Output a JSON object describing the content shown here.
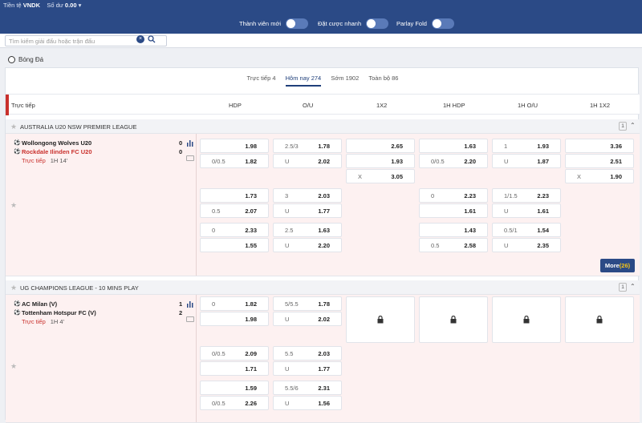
{
  "topbar": {
    "currency_label": "Tiền tệ",
    "currency": "VNDK",
    "balance_label": "Số dư",
    "balance": "0.00"
  },
  "toggles": [
    {
      "label": "Thành viên mới"
    },
    {
      "label": "Đặt cược nhanh"
    },
    {
      "label": "Parlay Fold"
    }
  ],
  "search": {
    "placeholder": "Tìm kiếm giải đấu hoặc trận đấu",
    "clear": "×"
  },
  "sport": "Bóng Đá",
  "tabs": [
    "Trực tiếp 4",
    "Hôm nay 274",
    "Sớm 1902",
    "Toàn bộ 86"
  ],
  "active_tab": 1,
  "columns": {
    "live": "Trực tiếp",
    "hdp": "HDP",
    "ou": "O/U",
    "x12": "1X2",
    "h1hdp": "1H HDP",
    "h1ou": "1H O/U",
    "h1x12": "1H 1X2"
  },
  "leagues": [
    {
      "name": "AUSTRALIA U20 NSW PREMIER LEAGUE",
      "count": "1",
      "match": {
        "home": "Wollongong Wolves U20",
        "away": "Rockdale Ilinden FC U20",
        "home_score": "0",
        "away_score": "0",
        "live": "Trực tiếp",
        "time": "1H 14'",
        "more_label": "More",
        "more_count": "(26)"
      },
      "cells": [
        {
          "col": 0,
          "row": 0,
          "h": "",
          "o": "1.98"
        },
        {
          "col": 0,
          "row": 1,
          "h": "0/0.5",
          "o": "1.82"
        },
        {
          "col": 1,
          "row": 0,
          "h": "2.5/3",
          "o": "1.78"
        },
        {
          "col": 1,
          "row": 1,
          "h": "U",
          "o": "2.02"
        },
        {
          "col": 2,
          "row": 0,
          "h": "",
          "o": "2.65"
        },
        {
          "col": 2,
          "row": 1,
          "h": "",
          "o": "1.93"
        },
        {
          "col": 2,
          "row": 2,
          "h": "X",
          "o": "3.05"
        },
        {
          "col": 3,
          "row": 0,
          "h": "",
          "o": "1.63"
        },
        {
          "col": 3,
          "row": 1,
          "h": "0/0.5",
          "o": "2.20"
        },
        {
          "col": 4,
          "row": 0,
          "h": "1",
          "o": "1.93"
        },
        {
          "col": 4,
          "row": 1,
          "h": "U",
          "o": "1.87"
        },
        {
          "col": 5,
          "row": 0,
          "h": "",
          "o": "3.36"
        },
        {
          "col": 5,
          "row": 1,
          "h": "",
          "o": "2.51"
        },
        {
          "col": 5,
          "row": 2,
          "h": "X",
          "o": "1.90"
        },
        {
          "col": 0,
          "row": 3,
          "h": "",
          "o": "1.73"
        },
        {
          "col": 0,
          "row": 4,
          "h": "0.5",
          "o": "2.07"
        },
        {
          "col": 1,
          "row": 3,
          "h": "3",
          "o": "2.03"
        },
        {
          "col": 1,
          "row": 4,
          "h": "U",
          "o": "1.77"
        },
        {
          "col": 3,
          "row": 3,
          "h": "0",
          "o": "2.23"
        },
        {
          "col": 3,
          "row": 4,
          "h": "",
          "o": "1.61"
        },
        {
          "col": 4,
          "row": 3,
          "h": "1/1.5",
          "o": "2.23"
        },
        {
          "col": 4,
          "row": 4,
          "h": "U",
          "o": "1.61"
        },
        {
          "col": 0,
          "row": 5,
          "h": "0",
          "o": "2.33"
        },
        {
          "col": 0,
          "row": 6,
          "h": "",
          "o": "1.55"
        },
        {
          "col": 1,
          "row": 5,
          "h": "2.5",
          "o": "1.63"
        },
        {
          "col": 1,
          "row": 6,
          "h": "U",
          "o": "2.20"
        },
        {
          "col": 3,
          "row": 5,
          "h": "",
          "o": "1.43"
        },
        {
          "col": 3,
          "row": 6,
          "h": "0.5",
          "o": "2.58"
        },
        {
          "col": 4,
          "row": 5,
          "h": "0.5/1",
          "o": "1.54"
        },
        {
          "col": 4,
          "row": 6,
          "h": "U",
          "o": "2.35"
        }
      ]
    },
    {
      "name": "UG CHAMPIONS LEAGUE - 10 MINS PLAY",
      "count": "1",
      "match": {
        "home": "AC Milan (V)",
        "away": "Tottenham Hotspur FC (V)",
        "home_score": "1",
        "away_score": "2",
        "live": "Trực tiếp",
        "time": "1H 4'"
      },
      "cells": [
        {
          "col": 0,
          "row": 0,
          "h": "0",
          "o": "1.82"
        },
        {
          "col": 0,
          "row": 1,
          "h": "",
          "o": "1.98"
        },
        {
          "col": 1,
          "row": 0,
          "h": "5/5.5",
          "o": "1.78"
        },
        {
          "col": 1,
          "row": 1,
          "h": "U",
          "o": "2.02"
        },
        {
          "col": 0,
          "row": 3,
          "h": "0/0.5",
          "o": "2.09"
        },
        {
          "col": 0,
          "row": 4,
          "h": "",
          "o": "1.71"
        },
        {
          "col": 1,
          "row": 3,
          "h": "5.5",
          "o": "2.03"
        },
        {
          "col": 1,
          "row": 4,
          "h": "U",
          "o": "1.77"
        },
        {
          "col": 0,
          "row": 5,
          "h": "",
          "o": "1.59"
        },
        {
          "col": 0,
          "row": 6,
          "h": "0/0.5",
          "o": "2.26"
        },
        {
          "col": 1,
          "row": 5,
          "h": "5.5/6",
          "o": "2.31"
        },
        {
          "col": 1,
          "row": 6,
          "h": "U",
          "o": "1.56"
        }
      ]
    }
  ]
}
